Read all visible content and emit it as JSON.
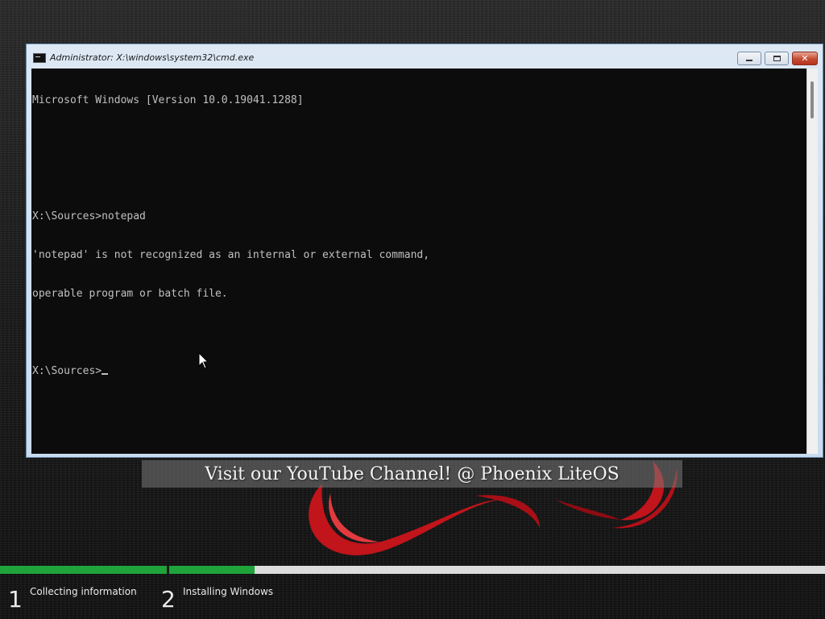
{
  "window": {
    "title": "Administrator: X:\\windows\\system32\\cmd.exe",
    "close_label": "✕"
  },
  "console": {
    "lines": [
      "Microsoft Windows [Version 10.0.19041.1288]",
      "",
      "",
      "X:\\Sources>notepad",
      "'notepad' is not recognized as an internal or external command,",
      "operable program or batch file.",
      "",
      "X:\\Sources>"
    ],
    "text_color": "#c0c0c0",
    "background_color": "#0c0c0c"
  },
  "banner": {
    "text": "Visit our YouTube Channel! @ Phoenix LiteOS"
  },
  "setup": {
    "steps": [
      {
        "number": "1",
        "label": "Collecting information",
        "progress": 1.0
      },
      {
        "number": "2",
        "label": "Installing Windows",
        "progress": 0.13
      }
    ],
    "progress_color": "#1fa33a"
  }
}
